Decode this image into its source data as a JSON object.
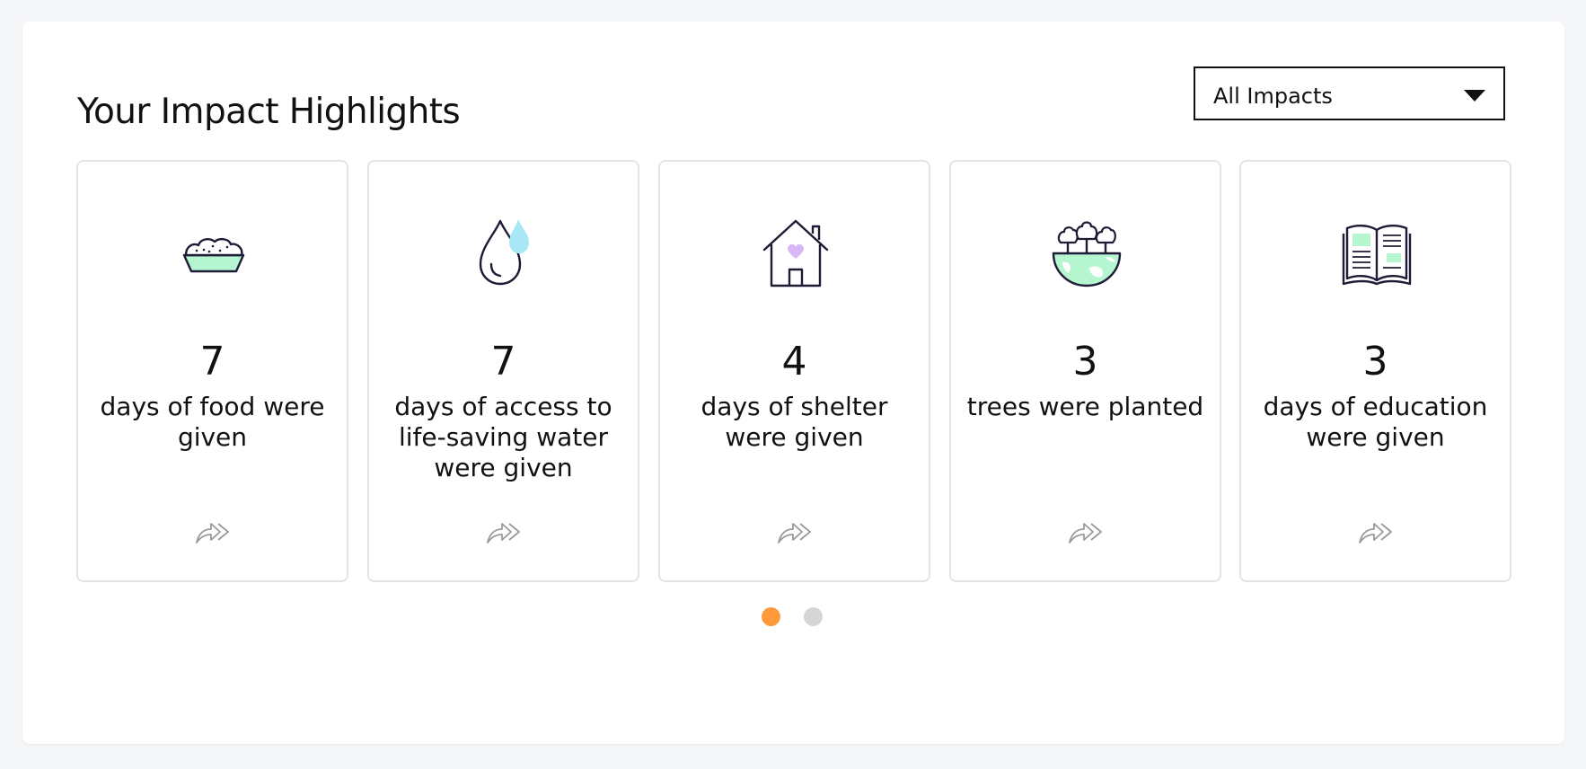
{
  "title": "Your Impact Highlights",
  "filter": {
    "selected": "All Impacts"
  },
  "colors": {
    "accent_green": "#b5f5cf",
    "accent_blue": "#a8e8f6",
    "accent_purple": "#d9b6f5",
    "dot_active": "#ff9a3c",
    "dot_inactive": "#d6d6d6",
    "stroke": "#1f1b36"
  },
  "cards": [
    {
      "icon": "food-bowl-icon",
      "value": "7",
      "text": "days of food were given"
    },
    {
      "icon": "water-drop-icon",
      "value": "7",
      "text": "days of access to life-saving water were given"
    },
    {
      "icon": "house-heart-icon",
      "value": "4",
      "text": "days of shelter were given"
    },
    {
      "icon": "globe-trees-icon",
      "value": "3",
      "text": "trees were planted"
    },
    {
      "icon": "open-book-icon",
      "value": "3",
      "text": "days of education were given"
    }
  ],
  "pagination": {
    "pages": 2,
    "current": 1
  }
}
